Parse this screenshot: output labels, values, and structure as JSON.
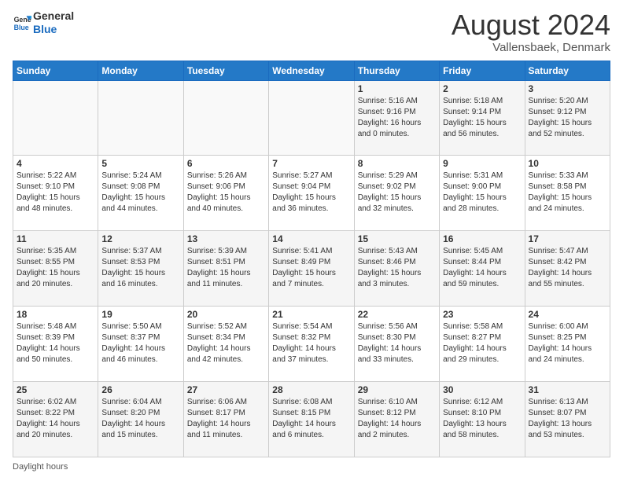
{
  "header": {
    "logo_text_general": "General",
    "logo_text_blue": "Blue",
    "month_title": "August 2024",
    "subtitle": "Vallensbaek, Denmark"
  },
  "days_of_week": [
    "Sunday",
    "Monday",
    "Tuesday",
    "Wednesday",
    "Thursday",
    "Friday",
    "Saturday"
  ],
  "weeks": [
    [
      {
        "day": "",
        "info": ""
      },
      {
        "day": "",
        "info": ""
      },
      {
        "day": "",
        "info": ""
      },
      {
        "day": "",
        "info": ""
      },
      {
        "day": "1",
        "info": "Sunrise: 5:16 AM\nSunset: 9:16 PM\nDaylight: 16 hours\nand 0 minutes."
      },
      {
        "day": "2",
        "info": "Sunrise: 5:18 AM\nSunset: 9:14 PM\nDaylight: 15 hours\nand 56 minutes."
      },
      {
        "day": "3",
        "info": "Sunrise: 5:20 AM\nSunset: 9:12 PM\nDaylight: 15 hours\nand 52 minutes."
      }
    ],
    [
      {
        "day": "4",
        "info": "Sunrise: 5:22 AM\nSunset: 9:10 PM\nDaylight: 15 hours\nand 48 minutes."
      },
      {
        "day": "5",
        "info": "Sunrise: 5:24 AM\nSunset: 9:08 PM\nDaylight: 15 hours\nand 44 minutes."
      },
      {
        "day": "6",
        "info": "Sunrise: 5:26 AM\nSunset: 9:06 PM\nDaylight: 15 hours\nand 40 minutes."
      },
      {
        "day": "7",
        "info": "Sunrise: 5:27 AM\nSunset: 9:04 PM\nDaylight: 15 hours\nand 36 minutes."
      },
      {
        "day": "8",
        "info": "Sunrise: 5:29 AM\nSunset: 9:02 PM\nDaylight: 15 hours\nand 32 minutes."
      },
      {
        "day": "9",
        "info": "Sunrise: 5:31 AM\nSunset: 9:00 PM\nDaylight: 15 hours\nand 28 minutes."
      },
      {
        "day": "10",
        "info": "Sunrise: 5:33 AM\nSunset: 8:58 PM\nDaylight: 15 hours\nand 24 minutes."
      }
    ],
    [
      {
        "day": "11",
        "info": "Sunrise: 5:35 AM\nSunset: 8:55 PM\nDaylight: 15 hours\nand 20 minutes."
      },
      {
        "day": "12",
        "info": "Sunrise: 5:37 AM\nSunset: 8:53 PM\nDaylight: 15 hours\nand 16 minutes."
      },
      {
        "day": "13",
        "info": "Sunrise: 5:39 AM\nSunset: 8:51 PM\nDaylight: 15 hours\nand 11 minutes."
      },
      {
        "day": "14",
        "info": "Sunrise: 5:41 AM\nSunset: 8:49 PM\nDaylight: 15 hours\nand 7 minutes."
      },
      {
        "day": "15",
        "info": "Sunrise: 5:43 AM\nSunset: 8:46 PM\nDaylight: 15 hours\nand 3 minutes."
      },
      {
        "day": "16",
        "info": "Sunrise: 5:45 AM\nSunset: 8:44 PM\nDaylight: 14 hours\nand 59 minutes."
      },
      {
        "day": "17",
        "info": "Sunrise: 5:47 AM\nSunset: 8:42 PM\nDaylight: 14 hours\nand 55 minutes."
      }
    ],
    [
      {
        "day": "18",
        "info": "Sunrise: 5:48 AM\nSunset: 8:39 PM\nDaylight: 14 hours\nand 50 minutes."
      },
      {
        "day": "19",
        "info": "Sunrise: 5:50 AM\nSunset: 8:37 PM\nDaylight: 14 hours\nand 46 minutes."
      },
      {
        "day": "20",
        "info": "Sunrise: 5:52 AM\nSunset: 8:34 PM\nDaylight: 14 hours\nand 42 minutes."
      },
      {
        "day": "21",
        "info": "Sunrise: 5:54 AM\nSunset: 8:32 PM\nDaylight: 14 hours\nand 37 minutes."
      },
      {
        "day": "22",
        "info": "Sunrise: 5:56 AM\nSunset: 8:30 PM\nDaylight: 14 hours\nand 33 minutes."
      },
      {
        "day": "23",
        "info": "Sunrise: 5:58 AM\nSunset: 8:27 PM\nDaylight: 14 hours\nand 29 minutes."
      },
      {
        "day": "24",
        "info": "Sunrise: 6:00 AM\nSunset: 8:25 PM\nDaylight: 14 hours\nand 24 minutes."
      }
    ],
    [
      {
        "day": "25",
        "info": "Sunrise: 6:02 AM\nSunset: 8:22 PM\nDaylight: 14 hours\nand 20 minutes."
      },
      {
        "day": "26",
        "info": "Sunrise: 6:04 AM\nSunset: 8:20 PM\nDaylight: 14 hours\nand 15 minutes."
      },
      {
        "day": "27",
        "info": "Sunrise: 6:06 AM\nSunset: 8:17 PM\nDaylight: 14 hours\nand 11 minutes."
      },
      {
        "day": "28",
        "info": "Sunrise: 6:08 AM\nSunset: 8:15 PM\nDaylight: 14 hours\nand 6 minutes."
      },
      {
        "day": "29",
        "info": "Sunrise: 6:10 AM\nSunset: 8:12 PM\nDaylight: 14 hours\nand 2 minutes."
      },
      {
        "day": "30",
        "info": "Sunrise: 6:12 AM\nSunset: 8:10 PM\nDaylight: 13 hours\nand 58 minutes."
      },
      {
        "day": "31",
        "info": "Sunrise: 6:13 AM\nSunset: 8:07 PM\nDaylight: 13 hours\nand 53 minutes."
      }
    ]
  ],
  "footer": {
    "note": "Daylight hours"
  }
}
